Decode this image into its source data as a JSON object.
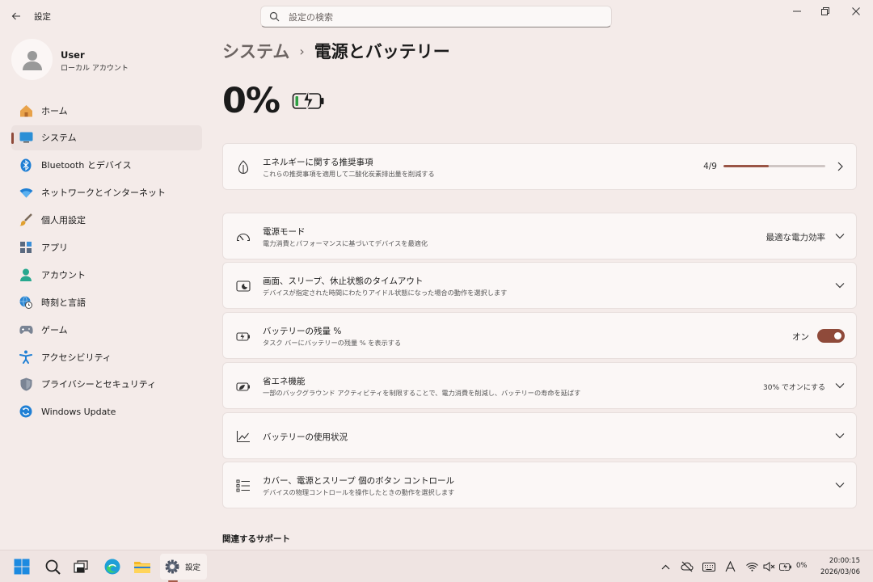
{
  "app": {
    "title": "設定"
  },
  "search": {
    "placeholder": "設定の検索"
  },
  "profile": {
    "name": "User",
    "account_type": "ローカル アカウント"
  },
  "sidebar": {
    "items": [
      {
        "label": "ホーム",
        "icon": "home-icon"
      },
      {
        "label": "システム",
        "icon": "system-icon",
        "active": true
      },
      {
        "label": "Bluetooth とデバイス",
        "icon": "bluetooth-icon"
      },
      {
        "label": "ネットワークとインターネット",
        "icon": "network-icon"
      },
      {
        "label": "個人用設定",
        "icon": "brush-icon"
      },
      {
        "label": "アプリ",
        "icon": "apps-icon"
      },
      {
        "label": "アカウント",
        "icon": "account-icon"
      },
      {
        "label": "時刻と言語",
        "icon": "globe-clock-icon"
      },
      {
        "label": "ゲーム",
        "icon": "gamepad-icon"
      },
      {
        "label": "アクセシビリティ",
        "icon": "accessibility-icon"
      },
      {
        "label": "プライバシーとセキュリティ",
        "icon": "shield-icon"
      },
      {
        "label": "Windows Update",
        "icon": "update-icon"
      }
    ]
  },
  "breadcrumb": {
    "parent": "システム",
    "separator": "›",
    "current": "電源とバッテリー"
  },
  "battery": {
    "percent_label": "0%",
    "icon": "battery-charging-icon"
  },
  "energy_card": {
    "title": "エネルギーに関する推奨事項",
    "subtitle": "これらの推奨事項を適用して二酸化炭素排出量を削減する",
    "progress_label": "4/9",
    "progress_fraction": 0.444
  },
  "cards": {
    "power_mode": {
      "title": "電源モード",
      "subtitle": "電力消費とパフォーマンスに基づいてデバイスを最適化",
      "value": "最適な電力効率"
    },
    "screen_sleep": {
      "title": "画面、スリープ、休止状態のタイムアウト",
      "subtitle": "デバイスが指定された時間にわたりアイドル状態になった場合の動作を選択します"
    },
    "battery_percent": {
      "title": "バッテリーの残量 %",
      "subtitle": "タスク バーにバッテリーの残量 % を表示する",
      "toggle_label": "オン",
      "toggle_on": true
    },
    "energy_saver": {
      "title": "省エネ機能",
      "subtitle": "一部のバックグラウンド アクティビティを制限することで、電力消費を削減し、バッテリーの寿命を延ばす",
      "value": "30% でオンにする"
    },
    "battery_usage": {
      "title": "バッテリーの使用状況"
    },
    "lid_buttons": {
      "title": "カバー、電源とスリープ 個のボタン コントロール",
      "subtitle": "デバイスの物理コントロールを操作したときの動作を選択します"
    }
  },
  "related": {
    "title": "関連するサポート"
  },
  "taskbar": {
    "settings_label": "設定",
    "battery_pct": "0%",
    "time": "20:00:15",
    "date": "2026/03/06"
  },
  "colors": {
    "accent": "#8f4a3a",
    "background": "#f4ebe9",
    "card": "#fbf7f6"
  }
}
